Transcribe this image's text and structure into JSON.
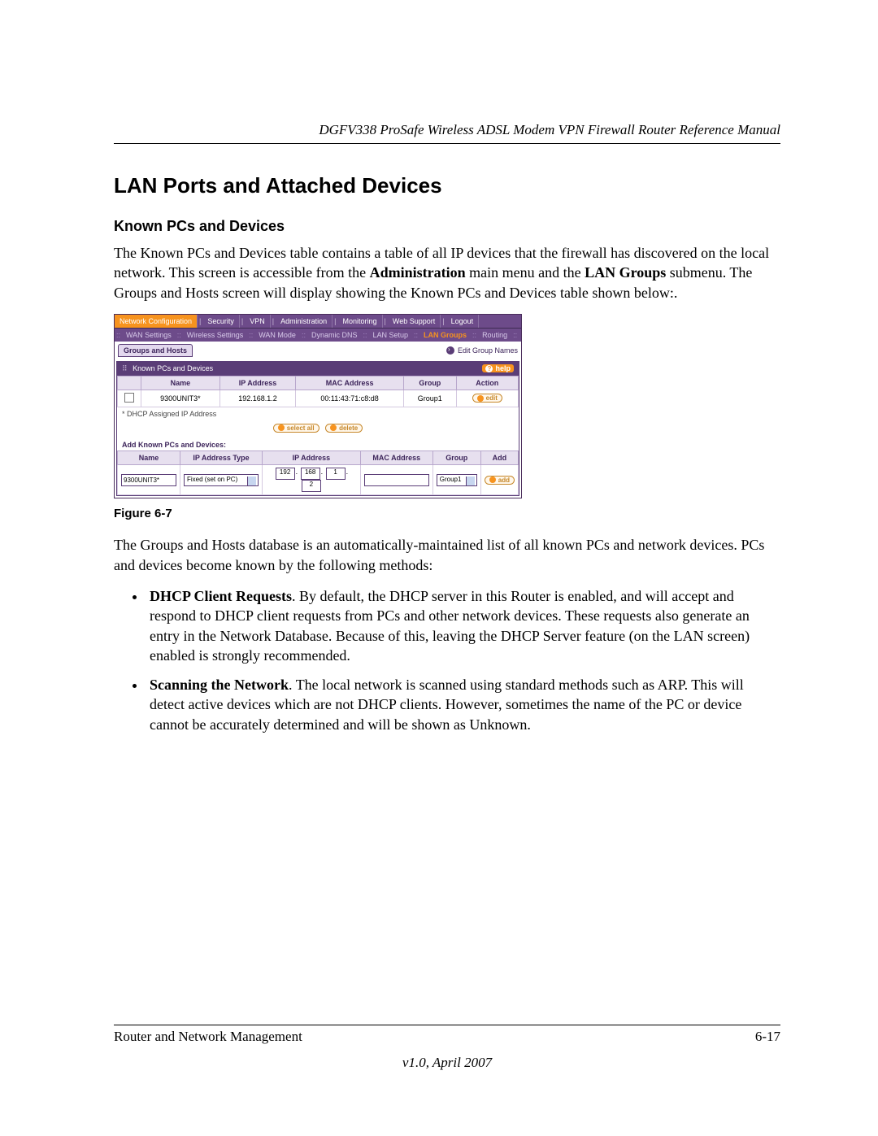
{
  "running_head": "DGFV338 ProSafe Wireless ADSL Modem VPN Firewall Router Reference Manual",
  "section_title": "LAN Ports and Attached Devices",
  "sub_title": "Known PCs and Devices",
  "intro_para_before_admin": "The Known PCs and Devices table contains a table of all IP devices that the firewall has discovered on the local network. This screen is accessible from the ",
  "bold_admin": "Administration",
  "intro_mid": " main menu and the ",
  "bold_lan_groups": "LAN Groups",
  "intro_after": " submenu. The Groups and Hosts screen will display showing the Known PCs and Devices table shown below:.",
  "figure_caption": "Figure 6-7",
  "post_figure_para": "The Groups and Hosts database is an automatically-maintained list of all known PCs and network devices. PCs and devices become known by the following methods:",
  "bullets": [
    {
      "lead": "DHCP Client Requests",
      "rest": ". By default, the DHCP server in this Router is enabled, and will accept and respond to DHCP client requests from PCs and other network devices. These requests also generate an entry in the Network Database. Because of this, leaving the DHCP Server feature (on the LAN screen) enabled is strongly recommended."
    },
    {
      "lead": "Scanning the Network",
      "rest": ". The local network is scanned using standard methods such as ARP. This will detect active devices which are not DHCP clients. However, sometimes the name of the PC or device cannot be accurately determined and will be shown as Unknown."
    }
  ],
  "footer": {
    "left": "Router and Network Management",
    "right": "6-17",
    "version": "v1.0, April 2007"
  },
  "router_ui": {
    "primary_tabs": [
      "Network Configuration",
      "Security",
      "VPN",
      "Administration",
      "Monitoring",
      "Web Support",
      "Logout"
    ],
    "primary_active_index": 0,
    "secondary_tabs": [
      "WAN Settings",
      "Wireless Settings",
      "WAN Mode",
      "Dynamic DNS",
      "LAN Setup",
      "LAN Groups",
      "Routing"
    ],
    "secondary_active_index": 5,
    "groups_tab": "Groups and Hosts",
    "edit_group": "Edit Group Names",
    "panel_title": "Known PCs and Devices",
    "help_label": "help",
    "table_headers": [
      "",
      "Name",
      "IP Address",
      "MAC Address",
      "Group",
      "Action"
    ],
    "table_row": {
      "name": "9300UNIT3*",
      "ip": "192.168.1.2",
      "mac": "00:11:43:71:c8:d8",
      "group": "Group1",
      "action": "edit"
    },
    "dhcp_note": "* DHCP Assigned IP Address",
    "btn_select_all": "select all",
    "btn_delete": "delete",
    "add_section_title": "Add Known PCs and Devices:",
    "add_headers": [
      "Name",
      "IP Address Type",
      "IP Address",
      "MAC Address",
      "Group",
      "Add"
    ],
    "add_row": {
      "name": "9300UNIT3*",
      "type": "Fixed (set on PC)",
      "ip_octets": [
        "192",
        "168",
        "1",
        "2"
      ],
      "mac": "",
      "group": "Group1",
      "add_btn": "add"
    }
  }
}
